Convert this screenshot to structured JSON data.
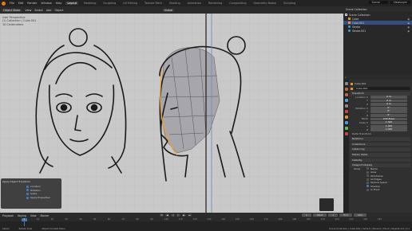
{
  "topbar": {
    "menus": [
      "File",
      "Edit",
      "Render",
      "Window",
      "Help"
    ],
    "workspaces": [
      "Layout",
      "Modeling",
      "Sculpting",
      "UV Editing",
      "Texture Paint",
      "Shading",
      "Animation",
      "Rendering",
      "Compositing",
      "Geometry Nodes",
      "Scripting"
    ],
    "active_workspace": "Layout",
    "scene": "Scene",
    "view_layer": "ViewLayer"
  },
  "viewport": {
    "mode": "Object Mode",
    "menus": [
      "View",
      "Select",
      "Add",
      "Object"
    ],
    "orientation": "Global",
    "overlay_text": [
      "User Perspective",
      "(1) Collection | Cube.001",
      "10 Centimeters"
    ]
  },
  "redo_panel": {
    "title": "Apply Object Transform",
    "options": [
      {
        "label": "Location",
        "checked": true
      },
      {
        "label": "Rotation",
        "checked": true
      },
      {
        "label": "Scale",
        "checked": true
      },
      {
        "label": "Apply Properties",
        "checked": true
      }
    ]
  },
  "outliner": {
    "header": "Scene Collection",
    "rows": [
      {
        "label": "Scene Collection",
        "icon": "collection-icon",
        "selected": false,
        "indent": 0
      },
      {
        "label": "Cube",
        "icon": "object-icon",
        "selected": false,
        "indent": 1
      },
      {
        "label": "Cube.001",
        "icon": "object-icon",
        "selected": true,
        "indent": 1
      },
      {
        "label": "Stroke",
        "icon": "grease-pencil-icon",
        "selected": false,
        "indent": 1
      },
      {
        "label": "Stroke.001",
        "icon": "grease-pencil-icon",
        "selected": false,
        "indent": 1
      }
    ]
  },
  "properties": {
    "object_name": "Cube.001",
    "panel_title": "Cube.001",
    "transform": "Transform",
    "location_label": "Location X",
    "location": [
      "0 m",
      "0 m",
      "0 m"
    ],
    "rotation_label": "Rotation X",
    "rotation": [
      "0°",
      "0°",
      "0°"
    ],
    "mode_label": "Mode",
    "mode": "XYZ Euler",
    "scale_label": "Scale X",
    "scale": [
      "1.000",
      "1.000",
      "1.000"
    ],
    "delta": "Delta Transform",
    "sections": [
      "Relations",
      "Collections",
      "Instancing",
      "Motion Paths",
      "Visibility",
      "Viewport Display"
    ],
    "show_label": "Show",
    "viewport_display": [
      {
        "label": "Name",
        "checked": false
      },
      {
        "label": "Axes",
        "checked": false
      },
      {
        "label": "Wireframe",
        "checked": false
      },
      {
        "label": "All Edges",
        "checked": false
      },
      {
        "label": "Texture Space",
        "checked": false
      },
      {
        "label": "Shadow",
        "checked": true
      },
      {
        "label": "In Front",
        "checked": false
      }
    ]
  },
  "timeline": {
    "menus": [
      "Playback",
      "Keying",
      "View",
      "Marker"
    ],
    "current_frame": "1",
    "start_label": "Start",
    "start": "1",
    "end_label": "End",
    "end": "250",
    "ticks": [
      "0",
      "10",
      "20",
      "30",
      "40",
      "50",
      "60",
      "70",
      "80",
      "90",
      "100",
      "110",
      "120",
      "130",
      "140",
      "150",
      "160",
      "170",
      "180",
      "190",
      "200",
      "210",
      "220",
      "230",
      "240",
      "250"
    ]
  },
  "statusbar": {
    "select": "Select",
    "rotate": "Rotate View",
    "menu": "Object Context Menu",
    "stats": "Scene Collection | Cube.001 | Verts:0 | Faces:0 | Tris:0 | Objects:1/4 | 3.x"
  }
}
